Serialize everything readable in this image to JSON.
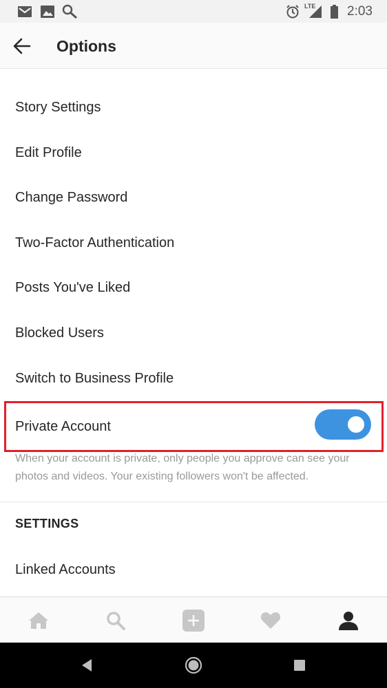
{
  "status_bar": {
    "time": "2:03",
    "network": "LTE",
    "icons": [
      "gmail-icon",
      "photos-icon",
      "app-notification-icon",
      "alarm-icon",
      "signal-icon",
      "battery-icon"
    ]
  },
  "header": {
    "title": "Options",
    "back_icon": "arrow-left-icon"
  },
  "menu": {
    "items": [
      {
        "label": "Story Settings"
      },
      {
        "label": "Edit Profile"
      },
      {
        "label": "Change Password"
      },
      {
        "label": "Two-Factor Authentication"
      },
      {
        "label": "Posts You've Liked"
      },
      {
        "label": "Blocked Users"
      },
      {
        "label": "Switch to Business Profile"
      }
    ]
  },
  "private_account": {
    "label": "Private Account",
    "enabled": true,
    "description": "When your account is private, only people you approve can see your photos and videos. Your existing followers won't be affected.",
    "toggle_color": "#3d93e0",
    "highlight_color": "#e0202a"
  },
  "settings_section": {
    "header": "SETTINGS",
    "items": [
      {
        "label": "Linked Accounts"
      }
    ]
  },
  "tab_bar": {
    "tabs": [
      "home-icon",
      "search-icon",
      "add-post-icon",
      "activity-heart-icon",
      "profile-icon"
    ],
    "active": "profile-icon"
  },
  "nav_bar": {
    "buttons": [
      "back-triangle-icon",
      "home-circle-icon",
      "recents-square-icon"
    ]
  }
}
